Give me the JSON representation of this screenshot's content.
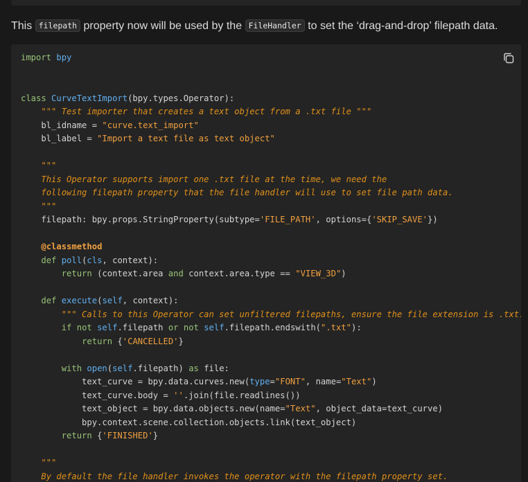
{
  "prose": {
    "t1": "This",
    "code1": "filepath",
    "t2": "property now will be used by the",
    "code2": "FileHandler",
    "t3": "to set the ‘drag-and-drop’ filepath data."
  },
  "code_block": {
    "copy_icon": "copy-icon",
    "lines": [
      [
        [
          "kw",
          "import"
        ],
        [
          "pl",
          " "
        ],
        [
          "nm",
          "bpy"
        ]
      ],
      [],
      [],
      [
        [
          "kw",
          "class"
        ],
        [
          "pl",
          " "
        ],
        [
          "nm",
          "CurveTextImport"
        ],
        [
          "pl",
          "(bpy.types.Operator):"
        ]
      ],
      [
        [
          "pl",
          "    "
        ],
        [
          "cm",
          "\"\"\" Test importer that creates a text object from a .txt file \"\"\""
        ]
      ],
      [
        [
          "pl",
          "    bl_idname = "
        ],
        [
          "st",
          "\"curve.text_import\""
        ]
      ],
      [
        [
          "pl",
          "    bl_label = "
        ],
        [
          "st",
          "\"Import a text file as text object\""
        ]
      ],
      [],
      [
        [
          "pl",
          "    "
        ],
        [
          "cm",
          "\"\"\""
        ]
      ],
      [
        [
          "pl",
          "    "
        ],
        [
          "cm",
          "This Operator supports import one .txt file at the time, we need the"
        ]
      ],
      [
        [
          "pl",
          "    "
        ],
        [
          "cm",
          "following filepath property that the file handler will use to set file path data."
        ]
      ],
      [
        [
          "pl",
          "    "
        ],
        [
          "cm",
          "\"\"\""
        ]
      ],
      [
        [
          "pl",
          "    filepath: bpy.props.StringProperty(subtype="
        ],
        [
          "st",
          "'FILE_PATH'"
        ],
        [
          "pl",
          ", options={"
        ],
        [
          "st",
          "'SKIP_SAVE'"
        ],
        [
          "pl",
          "})"
        ]
      ],
      [],
      [
        [
          "pl",
          "    "
        ],
        [
          "dc",
          "@classmethod"
        ]
      ],
      [
        [
          "pl",
          "    "
        ],
        [
          "kw",
          "def"
        ],
        [
          "pl",
          " "
        ],
        [
          "nm",
          "poll"
        ],
        [
          "pl",
          "("
        ],
        [
          "nm",
          "cls"
        ],
        [
          "pl",
          ", context):"
        ]
      ],
      [
        [
          "pl",
          "        "
        ],
        [
          "kw",
          "return"
        ],
        [
          "pl",
          " (context.area "
        ],
        [
          "kw",
          "and"
        ],
        [
          "pl",
          " context.area.type == "
        ],
        [
          "st",
          "\"VIEW_3D\""
        ],
        [
          "pl",
          ")"
        ]
      ],
      [],
      [
        [
          "pl",
          "    "
        ],
        [
          "kw",
          "def"
        ],
        [
          "pl",
          " "
        ],
        [
          "nm",
          "execute"
        ],
        [
          "pl",
          "("
        ],
        [
          "nm",
          "self"
        ],
        [
          "pl",
          ", context):"
        ]
      ],
      [
        [
          "pl",
          "        "
        ],
        [
          "cm",
          "\"\"\" Calls to this Operator can set unfiltered filepaths, ensure the file extension is .txt. \"\"\""
        ]
      ],
      [
        [
          "pl",
          "        "
        ],
        [
          "kw",
          "if"
        ],
        [
          "pl",
          " "
        ],
        [
          "kw",
          "not"
        ],
        [
          "pl",
          " "
        ],
        [
          "nm",
          "self"
        ],
        [
          "pl",
          ".filepath "
        ],
        [
          "kw",
          "or"
        ],
        [
          "pl",
          " "
        ],
        [
          "kw",
          "not"
        ],
        [
          "pl",
          " "
        ],
        [
          "nm",
          "self"
        ],
        [
          "pl",
          ".filepath.endswith("
        ],
        [
          "st",
          "\".txt\""
        ],
        [
          "pl",
          "):"
        ]
      ],
      [
        [
          "pl",
          "            "
        ],
        [
          "kw",
          "return"
        ],
        [
          "pl",
          " {"
        ],
        [
          "st",
          "'CANCELLED'"
        ],
        [
          "pl",
          "}"
        ]
      ],
      [],
      [
        [
          "pl",
          "        "
        ],
        [
          "kw",
          "with"
        ],
        [
          "pl",
          " "
        ],
        [
          "nm",
          "open"
        ],
        [
          "pl",
          "("
        ],
        [
          "nm",
          "self"
        ],
        [
          "pl",
          ".filepath) "
        ],
        [
          "kw",
          "as"
        ],
        [
          "pl",
          " file:"
        ]
      ],
      [
        [
          "pl",
          "            text_curve = bpy.data.curves.new("
        ],
        [
          "nm",
          "type"
        ],
        [
          "pl",
          "="
        ],
        [
          "st",
          "\"FONT\""
        ],
        [
          "pl",
          ", name="
        ],
        [
          "st",
          "\"Text\""
        ],
        [
          "pl",
          ")"
        ]
      ],
      [
        [
          "pl",
          "            text_curve.body = "
        ],
        [
          "st",
          "''"
        ],
        [
          "pl",
          ".join(file.readlines())"
        ]
      ],
      [
        [
          "pl",
          "            text_object = bpy.data.objects.new(name="
        ],
        [
          "st",
          "\"Text\""
        ],
        [
          "pl",
          ", object_data=text_curve)"
        ]
      ],
      [
        [
          "pl",
          "            bpy.context.scene.collection.objects.link(text_object)"
        ]
      ],
      [
        [
          "pl",
          "        "
        ],
        [
          "kw",
          "return"
        ],
        [
          "pl",
          " {"
        ],
        [
          "st",
          "'FINISHED'"
        ],
        [
          "pl",
          "}"
        ]
      ],
      [],
      [
        [
          "pl",
          "    "
        ],
        [
          "cm",
          "\"\"\""
        ]
      ],
      [
        [
          "pl",
          "    "
        ],
        [
          "cm",
          "By default the file handler invokes the operator with the filepath property set."
        ]
      ]
    ]
  }
}
